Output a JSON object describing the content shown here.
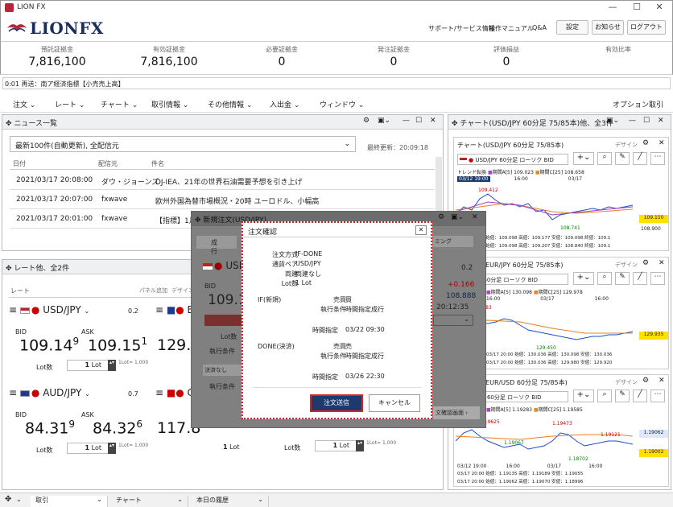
{
  "window": {
    "title": "LION FX"
  },
  "brand": "LIONFX",
  "header_links": [
    "サポート/サービス情報",
    "操作マニュアル",
    "Q&A"
  ],
  "header_buttons": [
    "設定",
    "お知らせ",
    "ログアウト"
  ],
  "summary": [
    {
      "label": "預託証拠金",
      "value": "7,816,100"
    },
    {
      "label": "有効証拠金",
      "value": "7,816,100"
    },
    {
      "label": "必要証拠金",
      "value": "0"
    },
    {
      "label": "発注証拠金",
      "value": "0"
    },
    {
      "label": "評価損益",
      "value": "0"
    },
    {
      "label": "有効比率",
      "value": ""
    }
  ],
  "ticker": "0:01  再送：南ア経済指標【小売売上高】",
  "menu": [
    "注文",
    "レート",
    "チャート",
    "取引情報",
    "その他情報",
    "入出金",
    "ウィンドウ"
  ],
  "menu_right": "オプション取引",
  "news": {
    "title": "ニュース一覧",
    "filter": "最新100件(自動更新), 全配信元",
    "updated": "最終更新：20:09:18",
    "columns": [
      "日付",
      "配信元",
      "件名"
    ],
    "rows": [
      {
        "date": "2021/03/17 20:08:00",
        "src": "ダウ・ジョーンズ",
        "subject": "DJ-IEA、21年の世界石油需要予想を引き上げ"
      },
      {
        "date": "2021/03/17 20:07:00",
        "src": "fxwave",
        "subject": "欧州外国為替市場概況・20時 ユーロドル、小幅高"
      },
      {
        "date": "2021/03/17 20:01:00",
        "src": "fxwave",
        "subject": "【指標】1月"
      }
    ]
  },
  "rates": {
    "title": "レート他、全2件",
    "sub_left": "レート",
    "sub_right": [
      "パネル追加",
      "デザイン"
    ],
    "cards": [
      {
        "pair": "USD/JPY",
        "spread": "0.2",
        "bid_label": "BID",
        "ask_label": "ASK",
        "bid_main": "109.14",
        "bid_sup": "9",
        "ask_main": "109.15",
        "ask_sup": "1",
        "lot_label": "Lot数",
        "lot": "1",
        "lot_unit": "Lot",
        "lot_note": "1Lot= 1,000"
      },
      {
        "pair": "AUD/JPY",
        "spread": "0.7",
        "bid_label": "BID",
        "ask_label": "ASK",
        "bid_main": "84.31",
        "bid_sup": "9",
        "ask_main": "84.32",
        "ask_sup": "6",
        "lot_label": "Lot数",
        "lot": "1",
        "lot_unit": "Lot",
        "lot_note": "1Lot= 1,000"
      }
    ],
    "partial": [
      {
        "pair": "EU",
        "bid": "129.9"
      },
      {
        "pair": "CH",
        "bid": "117.8"
      }
    ]
  },
  "order_window": {
    "title": "新規注文(USD/JPY)",
    "tab": "成行",
    "pair": "USD",
    "bid_label": "BID",
    "bid": "109.1",
    "lot_label": "Lot数",
    "cond_label": "執行条件",
    "settle_label": "決済なし",
    "spread": "0.2",
    "change": "+0.166",
    "high": "108.888",
    "time": "20:12:35",
    "right_label": "ミング",
    "screen_btn": "文確認画面"
  },
  "confirm": {
    "title": "注文確認",
    "rows": [
      {
        "k": "注文方式",
        "v": "IF-DONE"
      },
      {
        "k": "通貨ペア",
        "v": "USD/JPY"
      },
      {
        "k": "両建",
        "v": "両建なし"
      },
      {
        "k": "Lot数",
        "v": "1 Lot"
      }
    ],
    "if_label": "IF(新規)",
    "if_rows": [
      {
        "k": "売買",
        "v": "買"
      },
      {
        "k": "執行条件",
        "v": "時間指定成行"
      },
      {
        "k": "時間指定",
        "v": "03/22 09:30"
      }
    ],
    "done_label": "DONE(決済)",
    "done_rows": [
      {
        "k": "売買",
        "v": "売"
      },
      {
        "k": "執行条件",
        "v": "時間指定成行"
      },
      {
        "k": "時間指定",
        "v": "03/26 22:30"
      }
    ],
    "send": "注文送信",
    "cancel": "キャンセル"
  },
  "chart_panel": {
    "title": "チャート(USD/JPY 60分足 75/85本)他、全3件",
    "design": "デザイン",
    "charts": [
      {
        "title": "チャート(USD/JPY 60分足 75/85本)",
        "pair_sel": "USD/JPY  60分足 ローソク BID",
        "legend": [
          "期間A[5] 109.023",
          "期間C[25] 108.658"
        ],
        "trend": "トレンド転換",
        "times": [
          "03/12 19:00",
          "16:00",
          "03/17"
        ],
        "labels": [
          "109.412",
          "108.741"
        ],
        "price": "109.150",
        "price2": "108.900",
        "foot1": "03/17 20:00  始値：109.098  高値：109.177  安値：109.098  終値：109.1",
        "foot2": "03/17 20:00  始値：109.098  高値：109.207  安値：108.840  終値：109.1"
      },
      {
        "title": "チャート(EUR/JPY 60分足 75/85本)",
        "pair_sel": "EUR/JPY  60分足 ローソク BID",
        "legend": [
          "期間A[5] 130.098",
          "期間C[25] 129.978"
        ],
        "times": [
          "16:00",
          "03/17",
          "16:00"
        ],
        "labels": [
          "130.483",
          "129.450"
        ],
        "price": "129.935",
        "foot1": "03/17 20:00  始値：130.036  高値：130.098  安値：130.036",
        "foot2": "03/17 20:00  始値：130.036  高値：129.980  安値：129.920"
      },
      {
        "title": "チャート(EUR/USD 60分足 75/85本)",
        "pair_sel": "EUR/USD  60分足 ローソク BID",
        "legend": [
          "期間A[5] 1.19283",
          "期間C[25] 1.19585"
        ],
        "times": [
          "03/12 19:00",
          "16:00",
          "03/17",
          "16:00"
        ],
        "labels": [
          "1.19625",
          "1.19067",
          "1.19473",
          "1.19121",
          "1.18702"
        ],
        "price": "1.19062",
        "price2": "1.19002",
        "foot1": "03/17 20:00  始値：1.19135  高値：1.19189  安値：1.19055",
        "foot2": "03/17 20:00  始値：1.19062  高値：1.19070  安値：1.18996"
      }
    ]
  },
  "bottom_tabs": [
    "取引",
    "チャート",
    "本日の履歴"
  ],
  "colors": {
    "brand": "#1b2d5c",
    "accent_red": "#d22222",
    "send_btn": "#1e3a6d"
  }
}
